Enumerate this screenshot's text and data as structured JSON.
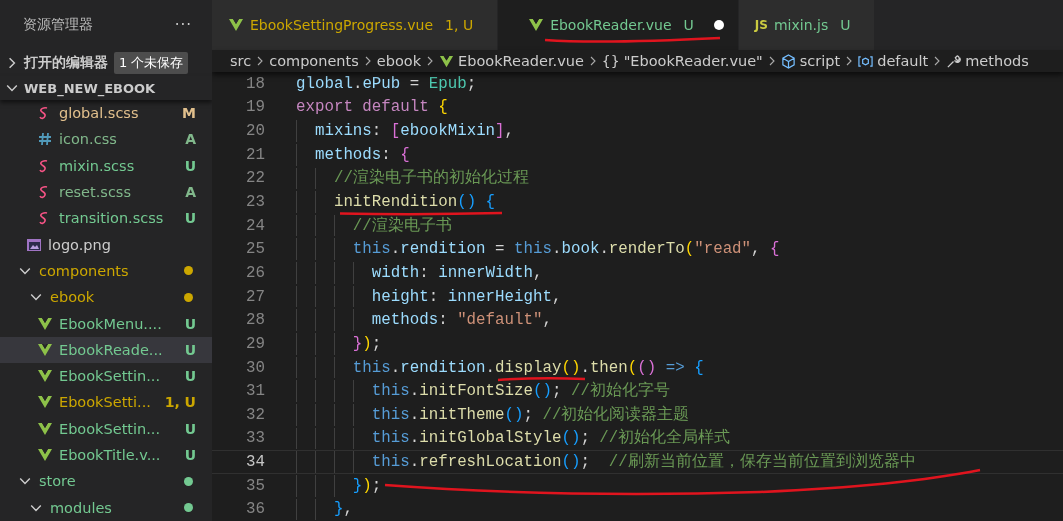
{
  "sidebar": {
    "title": "资源管理器",
    "more": "···",
    "open_editors": {
      "label": "打开的编辑器",
      "expanded": false,
      "badge": "1 个未保存"
    },
    "project": {
      "label": "WEB_NEW_EBOOK",
      "expanded": true
    },
    "tree": [
      {
        "children": [
          {
            "children": [
              {
                "label": "global.scss",
                "kind": "scss",
                "color": "#e2c08d",
                "badge": "M",
                "selected": false
              },
              {
                "label": "icon.css",
                "kind": "css",
                "color": "#81b88b",
                "badge": "A",
                "selected": false
              },
              {
                "label": "mixin.scss",
                "kind": "scss",
                "color": "#73c991",
                "badge": "U",
                "selected": false
              },
              {
                "label": "reset.scss",
                "kind": "scss",
                "color": "#81b88b",
                "badge": "A",
                "selected": false
              },
              {
                "label": "transition.scss",
                "kind": "scss",
                "color": "#73c991",
                "badge": "U",
                "selected": false
              }
            ]
          },
          {
            "label": "logo.png",
            "kind": "image",
            "color": "#cccccc",
            "selected": false
          }
        ]
      },
      {
        "label": "components",
        "kind": "folder",
        "color": "#cca700",
        "expanded": true,
        "selected": false,
        "children": [
          {
            "label": "ebook",
            "kind": "folder",
            "color": "#cca700",
            "expanded": true,
            "selected": false,
            "children": [
              {
                "label": "EbookMenu....",
                "kind": "vue",
                "color": "#73c991",
                "badge": "U",
                "selected": false
              },
              {
                "label": "EbookReade...",
                "kind": "vue",
                "color": "#73c991",
                "badge": "U",
                "selected": true
              },
              {
                "label": "EbookSettin...",
                "kind": "vue",
                "color": "#73c991",
                "badge": "U",
                "selected": false
              },
              {
                "label": "EbookSetti...",
                "kind": "vue",
                "color": "#cca700",
                "badge": "1, U",
                "selected": false
              },
              {
                "label": "EbookSettin...",
                "kind": "vue",
                "color": "#73c991",
                "badge": "U",
                "selected": false
              },
              {
                "label": "EbookTitle.v...",
                "kind": "vue",
                "color": "#73c991",
                "badge": "U",
                "selected": false
              }
            ]
          }
        ]
      },
      {
        "label": "store",
        "kind": "folder",
        "color": "#73c991",
        "expanded": true,
        "selected": false,
        "children": [
          {
            "label": "modules",
            "kind": "folder",
            "color": "#73c991",
            "expanded": true,
            "selected": false
          }
        ]
      }
    ]
  },
  "tabs": [
    {
      "label": "EbookSettingProgress.vue",
      "kind": "vue",
      "color": "#cca700",
      "badge": "1, U",
      "selected": false,
      "dirty": false
    },
    {
      "label": "EbookReader.vue",
      "kind": "vue",
      "color": "#73c991",
      "badge": "U",
      "selected": true,
      "dirty": true
    },
    {
      "label": "mixin.js",
      "kind": "js",
      "icon_label": "JS",
      "color": "#73c991",
      "badge": "U",
      "selected": false,
      "dirty": false
    }
  ],
  "breadcrumb": [
    {
      "label": "src",
      "kind": "plain"
    },
    {
      "label": "components",
      "kind": "plain"
    },
    {
      "label": "ebook",
      "kind": "plain"
    },
    {
      "label": "EbookReader.vue",
      "kind": "vue"
    },
    {
      "label": "\"EbookReader.vue\"",
      "kind": "text_icon",
      "icon_label": "{}"
    },
    {
      "label": "script",
      "kind": "module"
    },
    {
      "label": "default",
      "kind": "variable"
    },
    {
      "label": "methods",
      "kind": "method"
    }
  ],
  "code": [
    {
      "number": "18",
      "current": false,
      "tokens": [
        {
          "kind": "prop",
          "text": "global"
        },
        {
          "kind": "p",
          "text": "."
        },
        {
          "kind": "prop",
          "text": "ePub"
        },
        {
          "kind": "p",
          "text": " = "
        },
        {
          "kind": "cls",
          "text": "Epub"
        },
        {
          "kind": "p",
          "text": ";"
        }
      ]
    },
    {
      "number": "19",
      "current": false,
      "tokens": [
        {
          "kind": "kw",
          "text": "export default "
        },
        {
          "kind": "b1",
          "text": "{"
        }
      ]
    },
    {
      "number": "20",
      "current": false,
      "tokens": [
        {
          "kind": "prop",
          "text": "  mixins"
        },
        {
          "kind": "p",
          "text": ": "
        },
        {
          "kind": "b2",
          "text": "["
        },
        {
          "kind": "prop",
          "text": "ebookMixin"
        },
        {
          "kind": "b2",
          "text": "]"
        },
        {
          "kind": "p",
          "text": ","
        }
      ]
    },
    {
      "number": "21",
      "current": false,
      "tokens": [
        {
          "kind": "prop",
          "text": "  methods"
        },
        {
          "kind": "p",
          "text": ": "
        },
        {
          "kind": "b2",
          "text": "{"
        }
      ]
    },
    {
      "number": "22",
      "current": false,
      "tokens": [
        {
          "kind": "cm",
          "text": "    //渲染电子书的初始化过程"
        }
      ]
    },
    {
      "number": "23",
      "current": false,
      "tokens": [
        {
          "kind": "fn",
          "text": "    initRendition"
        },
        {
          "kind": "b3",
          "text": "() {"
        }
      ]
    },
    {
      "number": "24",
      "current": false,
      "tokens": [
        {
          "kind": "cm",
          "text": "      //渲染电子书"
        }
      ]
    },
    {
      "number": "25",
      "current": false,
      "tokens": [
        {
          "kind": "this",
          "text": "      this"
        },
        {
          "kind": "p",
          "text": "."
        },
        {
          "kind": "prop",
          "text": "rendition"
        },
        {
          "kind": "p",
          "text": " = "
        },
        {
          "kind": "this",
          "text": "this"
        },
        {
          "kind": "p",
          "text": "."
        },
        {
          "kind": "prop",
          "text": "book"
        },
        {
          "kind": "p",
          "text": "."
        },
        {
          "kind": "fn",
          "text": "renderTo"
        },
        {
          "kind": "b1",
          "text": "("
        },
        {
          "kind": "str",
          "text": "\"read\""
        },
        {
          "kind": "p",
          "text": ", "
        },
        {
          "kind": "b2",
          "text": "{"
        }
      ]
    },
    {
      "number": "26",
      "current": false,
      "tokens": [
        {
          "kind": "prop",
          "text": "        width"
        },
        {
          "kind": "p",
          "text": ": "
        },
        {
          "kind": "prop",
          "text": "innerWidth"
        },
        {
          "kind": "p",
          "text": ","
        }
      ]
    },
    {
      "number": "27",
      "current": false,
      "tokens": [
        {
          "kind": "prop",
          "text": "        height"
        },
        {
          "kind": "p",
          "text": ": "
        },
        {
          "kind": "prop",
          "text": "innerHeight"
        },
        {
          "kind": "p",
          "text": ","
        }
      ]
    },
    {
      "number": "28",
      "current": false,
      "tokens": [
        {
          "kind": "prop",
          "text": "        methods"
        },
        {
          "kind": "p",
          "text": ": "
        },
        {
          "kind": "str",
          "text": "\"default\""
        },
        {
          "kind": "p",
          "text": ","
        }
      ]
    },
    {
      "number": "29",
      "current": false,
      "tokens": [
        {
          "kind": "b2",
          "text": "      }"
        },
        {
          "kind": "b1",
          "text": ")"
        },
        {
          "kind": "p",
          "text": ";"
        }
      ]
    },
    {
      "number": "30",
      "current": false,
      "tokens": [
        {
          "kind": "this",
          "text": "      this"
        },
        {
          "kind": "p",
          "text": "."
        },
        {
          "kind": "prop",
          "text": "rendition"
        },
        {
          "kind": "p",
          "text": "."
        },
        {
          "kind": "fn",
          "text": "display"
        },
        {
          "kind": "b1",
          "text": "()"
        },
        {
          "kind": "p",
          "text": "."
        },
        {
          "kind": "fn",
          "text": "then"
        },
        {
          "kind": "b1",
          "text": "("
        },
        {
          "kind": "b2",
          "text": "()"
        },
        {
          "kind": "this",
          "text": " => "
        },
        {
          "kind": "b3",
          "text": "{"
        }
      ]
    },
    {
      "number": "31",
      "current": false,
      "tokens": [
        {
          "kind": "this",
          "text": "        this"
        },
        {
          "kind": "p",
          "text": "."
        },
        {
          "kind": "fn",
          "text": "initFontSize"
        },
        {
          "kind": "b3",
          "text": "()"
        },
        {
          "kind": "p",
          "text": ";"
        },
        {
          "kind": "cm",
          "text": " //初始化字号"
        }
      ]
    },
    {
      "number": "32",
      "current": false,
      "tokens": [
        {
          "kind": "this",
          "text": "        this"
        },
        {
          "kind": "p",
          "text": "."
        },
        {
          "kind": "fn",
          "text": "initTheme"
        },
        {
          "kind": "b3",
          "text": "()"
        },
        {
          "kind": "p",
          "text": ";"
        },
        {
          "kind": "cm",
          "text": " //初始化阅读器主题"
        }
      ]
    },
    {
      "number": "33",
      "current": false,
      "tokens": [
        {
          "kind": "this",
          "text": "        this"
        },
        {
          "kind": "p",
          "text": "."
        },
        {
          "kind": "fn",
          "text": "initGlobalStyle"
        },
        {
          "kind": "b3",
          "text": "()"
        },
        {
          "kind": "p",
          "text": ";"
        },
        {
          "kind": "cm",
          "text": " //初始化全局样式"
        }
      ]
    },
    {
      "number": "34",
      "current": true,
      "tokens": [
        {
          "kind": "this",
          "text": "        this"
        },
        {
          "kind": "p",
          "text": "."
        },
        {
          "kind": "fn",
          "text": "refreshLocation"
        },
        {
          "kind": "b3",
          "text": "()"
        },
        {
          "kind": "p",
          "text": ";"
        },
        {
          "kind": "cm",
          "text": "  //刷新当前位置，保存当前位置到浏览器中"
        }
      ]
    },
    {
      "number": "35",
      "current": false,
      "tokens": [
        {
          "kind": "b3",
          "text": "      }"
        },
        {
          "kind": "b1",
          "text": ")"
        },
        {
          "kind": "p",
          "text": ";"
        }
      ]
    },
    {
      "number": "36",
      "current": false,
      "tokens": [
        {
          "kind": "b3",
          "text": "    }"
        },
        {
          "kind": "p",
          "text": ","
        }
      ]
    }
  ]
}
